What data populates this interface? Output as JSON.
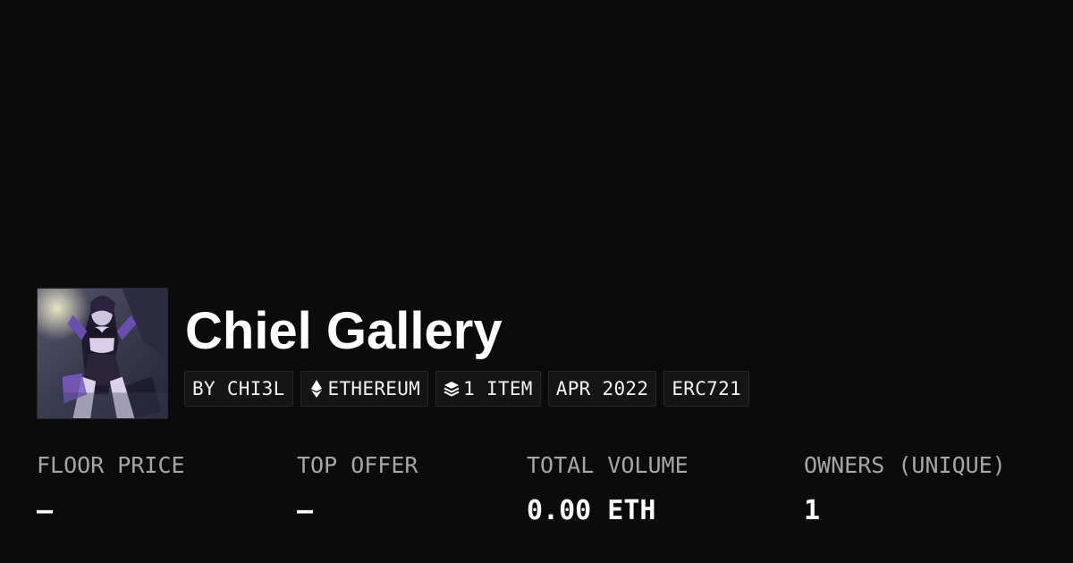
{
  "collection": {
    "title": "Chiel Gallery",
    "creator_chip": "BY CHI3L",
    "chain_chip": "ETHEREUM",
    "chain_icon": "ethereum-icon",
    "items_chip": "1 ITEM",
    "items_icon": "layers-icon",
    "date_chip": "APR 2022",
    "standard_chip": "ERC721",
    "avatar_icon": "collection-avatar-image"
  },
  "stats": [
    {
      "label": "FLOOR PRICE",
      "value": "—"
    },
    {
      "label": "TOP OFFER",
      "value": "—"
    },
    {
      "label": "TOTAL VOLUME",
      "value": "0.00 ETH"
    },
    {
      "label": "OWNERS (UNIQUE)",
      "value": "1"
    }
  ],
  "colors": {
    "background": "#0b0b0b",
    "text": "#ffffff",
    "muted_text": "#a6a6a6",
    "chip_background": "#151515",
    "chip_border": "#262626"
  }
}
